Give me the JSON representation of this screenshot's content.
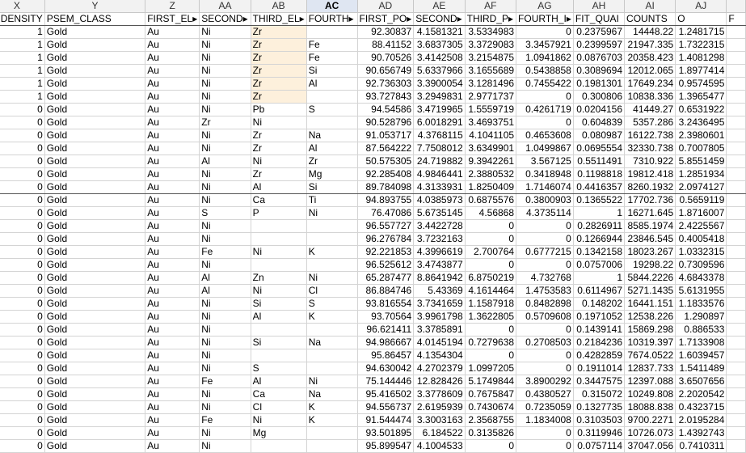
{
  "columns": [
    "X",
    "Y",
    "Z",
    "AA",
    "AB",
    "AC",
    "AD",
    "AE",
    "AF",
    "AG",
    "AH",
    "AI",
    "AJ"
  ],
  "active_column": "AC",
  "field_names": [
    "DENSITY",
    "PSEM_CLASS",
    "FIRST_EL▸",
    "SECOND▸",
    "THIRD_EL▸",
    "FOURTH▸",
    "FIRST_PO▸",
    "SECOND▸",
    "THIRD_P▸",
    "FOURTH_I▸",
    "FIT_QUAI",
    "COUNTS",
    "O",
    "F"
  ],
  "rows": [
    [
      "1",
      "Gold",
      "Au",
      "Ni",
      "Zr",
      "",
      "92.30837",
      "4.1581321",
      "3.5334983",
      "0",
      "0.2375967",
      "14448.22",
      "1.2481715"
    ],
    [
      "1",
      "Gold",
      "Au",
      "Ni",
      "Zr",
      "Fe",
      "88.41152",
      "3.6837305",
      "3.3729083",
      "3.3457921",
      "0.2399597",
      "21947.335",
      "1.7322315"
    ],
    [
      "1",
      "Gold",
      "Au",
      "Ni",
      "Zr",
      "Fe",
      "90.70526",
      "3.4142508",
      "3.2154875",
      "1.0941862",
      "0.0876703",
      "20358.423",
      "1.4081298"
    ],
    [
      "1",
      "Gold",
      "Au",
      "Ni",
      "Zr",
      "Si",
      "90.656749",
      "5.6337966",
      "3.1655689",
      "0.5438858",
      "0.3089694",
      "12012.065",
      "1.8977414"
    ],
    [
      "1",
      "Gold",
      "Au",
      "Ni",
      "Zr",
      "Al",
      "92.736303",
      "3.3900054",
      "3.1281496",
      "0.7455422",
      "0.1981301",
      "17649.234",
      "0.9574595"
    ],
    [
      "1",
      "Gold",
      "Au",
      "Ni",
      "Zr",
      "",
      "93.727843",
      "3.2949831",
      "2.9771737",
      "0",
      "0.300806",
      "10838.336",
      "1.3965477"
    ],
    [
      "0",
      "Gold",
      "Au",
      "Ni",
      "Pb",
      "S",
      "94.54586",
      "3.4719965",
      "1.5559719",
      "0.4261719",
      "0.0204156",
      "41449.27",
      "0.6531922"
    ],
    [
      "0",
      "Gold",
      "Au",
      "Zr",
      "Ni",
      "",
      "90.528796",
      "6.0018291",
      "3.4693751",
      "0",
      "0.604839",
      "5357.286",
      "3.2436495"
    ],
    [
      "0",
      "Gold",
      "Au",
      "Ni",
      "Zr",
      "Na",
      "91.053717",
      "4.3768115",
      "4.1041105",
      "0.4653608",
      "0.080987",
      "16122.738",
      "2.3980601"
    ],
    [
      "0",
      "Gold",
      "Au",
      "Ni",
      "Zr",
      "Al",
      "87.564222",
      "7.7508012",
      "3.6349901",
      "1.0499867",
      "0.0695554",
      "32330.738",
      "0.7007805"
    ],
    [
      "0",
      "Gold",
      "Au",
      "Al",
      "Ni",
      "Zr",
      "50.575305",
      "24.719882",
      "9.3942261",
      "3.567125",
      "0.5511491",
      "7310.922",
      "5.8551459"
    ],
    [
      "0",
      "Gold",
      "Au",
      "Ni",
      "Zr",
      "Mg",
      "92.285408",
      "4.9846441",
      "2.3880532",
      "0.3418948",
      "0.1198818",
      "19812.418",
      "1.2851934"
    ],
    [
      "0",
      "Gold",
      "Au",
      "Ni",
      "Al",
      "Si",
      "89.784098",
      "4.3133931",
      "1.8250409",
      "1.7146074",
      "0.4416357",
      "8260.1932",
      "2.0974127"
    ],
    [
      "0",
      "Gold",
      "Au",
      "Ni",
      "Ca",
      "Ti",
      "94.893755",
      "4.0385973",
      "0.6875576",
      "0.3800903",
      "0.1365522",
      "17702.736",
      "0.5659119"
    ],
    [
      "0",
      "Gold",
      "Au",
      "S",
      "P",
      "Ni",
      "76.47086",
      "5.6735145",
      "4.56868",
      "4.3735114",
      "1",
      "16271.645",
      "1.8716007"
    ],
    [
      "0",
      "Gold",
      "Au",
      "Ni",
      "",
      "",
      "96.557727",
      "3.4422728",
      "0",
      "0",
      "0.2826911",
      "8585.1974",
      "2.4225567"
    ],
    [
      "0",
      "Gold",
      "Au",
      "Ni",
      "",
      "",
      "96.276784",
      "3.7232163",
      "0",
      "0",
      "0.1266944",
      "23846.545",
      "0.4005418"
    ],
    [
      "0",
      "Gold",
      "Au",
      "Fe",
      "Ni",
      "K",
      "92.221853",
      "4.3996619",
      "2.700764",
      "0.6777215",
      "0.1342158",
      "18023.267",
      "1.0332315"
    ],
    [
      "0",
      "Gold",
      "Au",
      "Ni",
      "",
      "",
      "96.525612",
      "3.4743877",
      "0",
      "0",
      "0.0757006",
      "19298.22",
      "0.7309596"
    ],
    [
      "0",
      "Gold",
      "Au",
      "Al",
      "Zn",
      "Ni",
      "65.287477",
      "8.8641942",
      "6.8750219",
      "4.732768",
      "1",
      "5844.2226",
      "4.6843378"
    ],
    [
      "0",
      "Gold",
      "Au",
      "Al",
      "Ni",
      "Cl",
      "86.884746",
      "5.43369",
      "4.1614464",
      "1.4753583",
      "0.6114967",
      "5271.1435",
      "5.6131955"
    ],
    [
      "0",
      "Gold",
      "Au",
      "Ni",
      "Si",
      "S",
      "93.816554",
      "3.7341659",
      "1.1587918",
      "0.8482898",
      "0.148202",
      "16441.151",
      "1.1833576"
    ],
    [
      "0",
      "Gold",
      "Au",
      "Ni",
      "Al",
      "K",
      "93.70564",
      "3.9961798",
      "1.3622805",
      "0.5709608",
      "0.1971052",
      "12538.226",
      "1.290897"
    ],
    [
      "0",
      "Gold",
      "Au",
      "Ni",
      "",
      "",
      "96.621411",
      "3.3785891",
      "0",
      "0",
      "0.1439141",
      "15869.298",
      "0.886533"
    ],
    [
      "0",
      "Gold",
      "Au",
      "Ni",
      "Si",
      "Na",
      "94.986667",
      "4.0145194",
      "0.7279638",
      "0.2708503",
      "0.2184236",
      "10319.397",
      "1.7133908"
    ],
    [
      "0",
      "Gold",
      "Au",
      "Ni",
      "",
      "",
      "95.86457",
      "4.1354304",
      "0",
      "0",
      "0.4282859",
      "7674.0522",
      "1.6039457"
    ],
    [
      "0",
      "Gold",
      "Au",
      "Ni",
      "S",
      "",
      "94.630042",
      "4.2702379",
      "1.0997205",
      "0",
      "0.1911014",
      "12837.733",
      "1.5411489"
    ],
    [
      "0",
      "Gold",
      "Au",
      "Fe",
      "Al",
      "Ni",
      "75.144446",
      "12.828426",
      "5.1749844",
      "3.8900292",
      "0.3447575",
      "12397.088",
      "3.6507656"
    ],
    [
      "0",
      "Gold",
      "Au",
      "Ni",
      "Ca",
      "Na",
      "95.416502",
      "3.3778609",
      "0.7675847",
      "0.4380527",
      "0.315072",
      "10249.808",
      "2.2020542"
    ],
    [
      "0",
      "Gold",
      "Au",
      "Ni",
      "Cl",
      "K",
      "94.556737",
      "2.6195939",
      "0.7430674",
      "0.7235059",
      "0.1327735",
      "18088.838",
      "0.4323715"
    ],
    [
      "0",
      "Gold",
      "Au",
      "Fe",
      "Ni",
      "K",
      "91.544474",
      "3.3003163",
      "2.3568755",
      "1.1834008",
      "0.3103503",
      "9700.2271",
      "2.0195284"
    ],
    [
      "0",
      "Gold",
      "Au",
      "Ni",
      "Mg",
      "",
      "93.501895",
      "6.184522",
      "0.3135826",
      "0",
      "0.3119946",
      "10726.073",
      "1.4392743"
    ],
    [
      "0",
      "Gold",
      "Au",
      "Ni",
      "",
      "",
      "95.899547",
      "4.1004533",
      "0",
      "0",
      "0.0757114",
      "37047.056",
      "0.7410311"
    ]
  ],
  "highlight_rows": [
    0,
    1,
    2,
    3,
    4,
    5
  ],
  "highlight_col": 4,
  "numeric_cols": [
    0,
    6,
    7,
    8,
    9,
    10,
    11,
    12
  ]
}
